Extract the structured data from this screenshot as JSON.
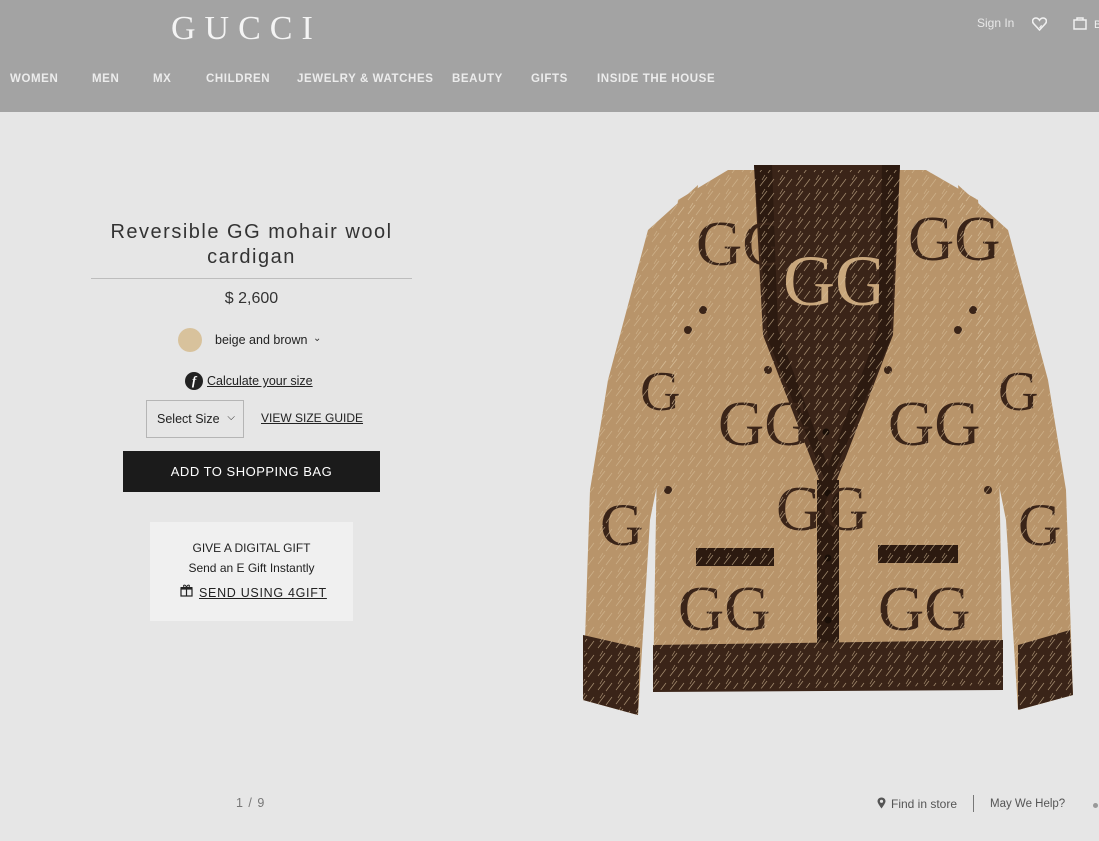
{
  "header": {
    "logo": "GUCCI",
    "sign_in": "Sign In",
    "nav": [
      {
        "label": "WOMEN"
      },
      {
        "label": "MEN"
      },
      {
        "label": "MX"
      },
      {
        "label": "CHILDREN"
      },
      {
        "label": "JEWELRY & WATCHES"
      },
      {
        "label": "BEAUTY"
      },
      {
        "label": "GIFTS"
      },
      {
        "label": "INSIDE THE HOUSE"
      }
    ]
  },
  "product": {
    "title": "Reversible GG mohair wool cardigan",
    "price": "$ 2,600",
    "color": "beige and brown",
    "swatch_color": "#d8c29c",
    "calc_size": "Calculate your size",
    "size_select": "Select Size",
    "size_guide": "VIEW SIZE GUIDE",
    "add_to_bag": "ADD TO SHOPPING BAG"
  },
  "gift": {
    "title": "GIVE A DIGITAL GIFT",
    "subtitle": "Send an E Gift Instantly",
    "link": "SEND USING 4GIFT"
  },
  "footer": {
    "pager": "1 / 9",
    "find_store": "Find in store",
    "help": "May We Help?"
  },
  "colors": {
    "header_bg": "#a3a3a3",
    "page_bg": "#e6e6e6",
    "button_bg": "#1b1b1b",
    "cardigan_beige": "#b8946a",
    "cardigan_brown": "#3a2418"
  }
}
